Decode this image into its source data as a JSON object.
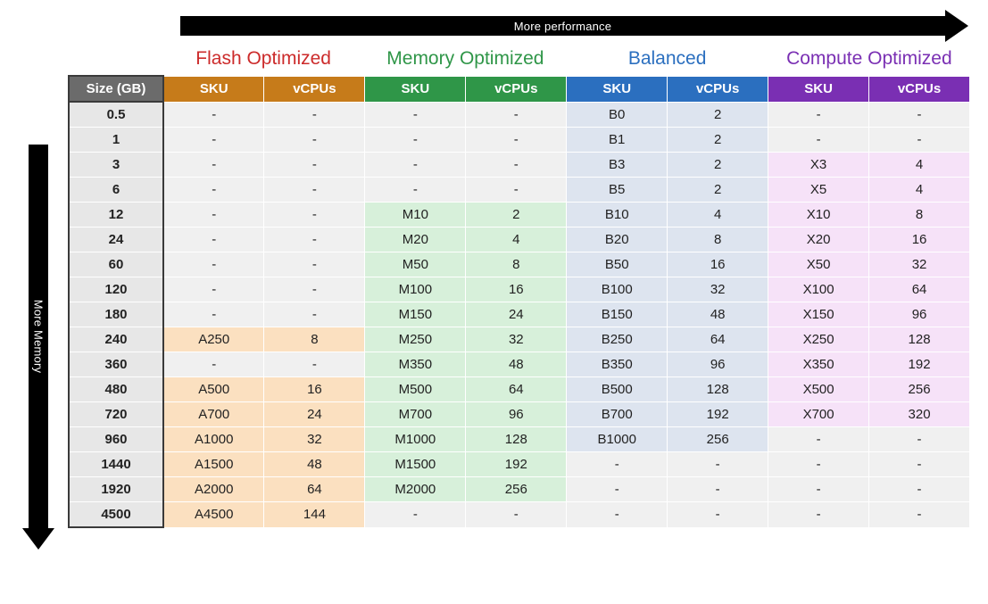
{
  "axes": {
    "top_label": "More performance",
    "left_label": "More Memory"
  },
  "size_header": "Size (GB)",
  "subheaders": {
    "sku": "SKU",
    "vcpus": "vCPUs"
  },
  "tiers": [
    {
      "key": "flash",
      "title": "Flash Optimized"
    },
    {
      "key": "memory",
      "title": "Memory Optimized"
    },
    {
      "key": "balanced",
      "title": "Balanced"
    },
    {
      "key": "compute",
      "title": "Compute Optimized"
    }
  ],
  "rows": [
    {
      "size": "0.5",
      "flash": {
        "sku": "-",
        "vcpus": "-"
      },
      "memory": {
        "sku": "-",
        "vcpus": "-"
      },
      "balanced": {
        "sku": "B0",
        "vcpus": "2"
      },
      "compute": {
        "sku": "-",
        "vcpus": "-"
      }
    },
    {
      "size": "1",
      "flash": {
        "sku": "-",
        "vcpus": "-"
      },
      "memory": {
        "sku": "-",
        "vcpus": "-"
      },
      "balanced": {
        "sku": "B1",
        "vcpus": "2"
      },
      "compute": {
        "sku": "-",
        "vcpus": "-"
      }
    },
    {
      "size": "3",
      "flash": {
        "sku": "-",
        "vcpus": "-"
      },
      "memory": {
        "sku": "-",
        "vcpus": "-"
      },
      "balanced": {
        "sku": "B3",
        "vcpus": "2"
      },
      "compute": {
        "sku": "X3",
        "vcpus": "4"
      }
    },
    {
      "size": "6",
      "flash": {
        "sku": "-",
        "vcpus": "-"
      },
      "memory": {
        "sku": "-",
        "vcpus": "-"
      },
      "balanced": {
        "sku": "B5",
        "vcpus": "2"
      },
      "compute": {
        "sku": "X5",
        "vcpus": "4"
      }
    },
    {
      "size": "12",
      "flash": {
        "sku": "-",
        "vcpus": "-"
      },
      "memory": {
        "sku": "M10",
        "vcpus": "2"
      },
      "balanced": {
        "sku": "B10",
        "vcpus": "4"
      },
      "compute": {
        "sku": "X10",
        "vcpus": "8"
      }
    },
    {
      "size": "24",
      "flash": {
        "sku": "-",
        "vcpus": "-"
      },
      "memory": {
        "sku": "M20",
        "vcpus": "4"
      },
      "balanced": {
        "sku": "B20",
        "vcpus": "8"
      },
      "compute": {
        "sku": "X20",
        "vcpus": "16"
      }
    },
    {
      "size": "60",
      "flash": {
        "sku": "-",
        "vcpus": "-"
      },
      "memory": {
        "sku": "M50",
        "vcpus": "8"
      },
      "balanced": {
        "sku": "B50",
        "vcpus": "16"
      },
      "compute": {
        "sku": "X50",
        "vcpus": "32"
      }
    },
    {
      "size": "120",
      "flash": {
        "sku": "-",
        "vcpus": "-"
      },
      "memory": {
        "sku": "M100",
        "vcpus": "16"
      },
      "balanced": {
        "sku": "B100",
        "vcpus": "32"
      },
      "compute": {
        "sku": "X100",
        "vcpus": "64"
      }
    },
    {
      "size": "180",
      "flash": {
        "sku": "-",
        "vcpus": "-"
      },
      "memory": {
        "sku": "M150",
        "vcpus": "24"
      },
      "balanced": {
        "sku": "B150",
        "vcpus": "48"
      },
      "compute": {
        "sku": "X150",
        "vcpus": "96"
      }
    },
    {
      "size": "240",
      "flash": {
        "sku": "A250",
        "vcpus": "8"
      },
      "memory": {
        "sku": "M250",
        "vcpus": "32"
      },
      "balanced": {
        "sku": "B250",
        "vcpus": "64"
      },
      "compute": {
        "sku": "X250",
        "vcpus": "128"
      }
    },
    {
      "size": "360",
      "flash": {
        "sku": "-",
        "vcpus": "-"
      },
      "memory": {
        "sku": "M350",
        "vcpus": "48"
      },
      "balanced": {
        "sku": "B350",
        "vcpus": "96"
      },
      "compute": {
        "sku": "X350",
        "vcpus": "192"
      }
    },
    {
      "size": "480",
      "flash": {
        "sku": "A500",
        "vcpus": "16"
      },
      "memory": {
        "sku": "M500",
        "vcpus": "64"
      },
      "balanced": {
        "sku": "B500",
        "vcpus": "128"
      },
      "compute": {
        "sku": "X500",
        "vcpus": "256"
      }
    },
    {
      "size": "720",
      "flash": {
        "sku": "A700",
        "vcpus": "24"
      },
      "memory": {
        "sku": "M700",
        "vcpus": "96"
      },
      "balanced": {
        "sku": "B700",
        "vcpus": "192"
      },
      "compute": {
        "sku": "X700",
        "vcpus": "320"
      }
    },
    {
      "size": "960",
      "flash": {
        "sku": "A1000",
        "vcpus": "32"
      },
      "memory": {
        "sku": "M1000",
        "vcpus": "128"
      },
      "balanced": {
        "sku": "B1000",
        "vcpus": "256"
      },
      "compute": {
        "sku": "-",
        "vcpus": "-"
      }
    },
    {
      "size": "1440",
      "flash": {
        "sku": "A1500",
        "vcpus": "48"
      },
      "memory": {
        "sku": "M1500",
        "vcpus": "192"
      },
      "balanced": {
        "sku": "-",
        "vcpus": "-"
      },
      "compute": {
        "sku": "-",
        "vcpus": "-"
      }
    },
    {
      "size": "1920",
      "flash": {
        "sku": "A2000",
        "vcpus": "64"
      },
      "memory": {
        "sku": "M2000",
        "vcpus": "256"
      },
      "balanced": {
        "sku": "-",
        "vcpus": "-"
      },
      "compute": {
        "sku": "-",
        "vcpus": "-"
      }
    },
    {
      "size": "4500",
      "flash": {
        "sku": "A4500",
        "vcpus": "144"
      },
      "memory": {
        "sku": "-",
        "vcpus": "-"
      },
      "balanced": {
        "sku": "-",
        "vcpus": "-"
      },
      "compute": {
        "sku": "-",
        "vcpus": "-"
      }
    }
  ]
}
